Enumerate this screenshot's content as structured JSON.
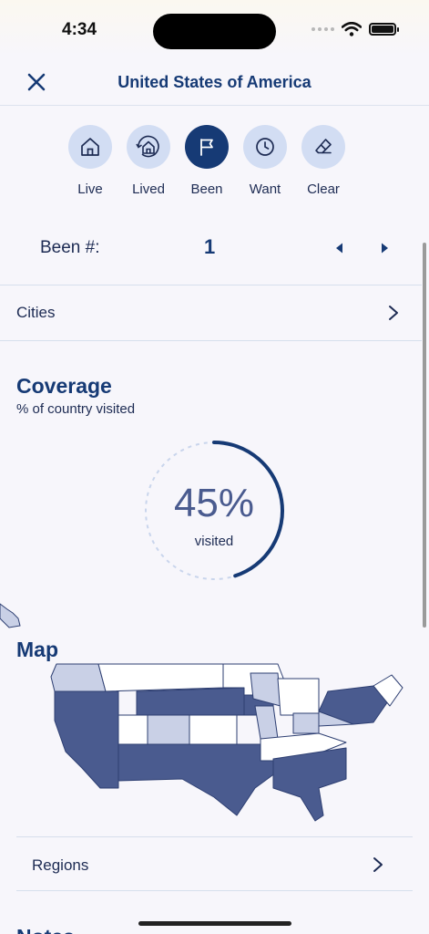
{
  "status_bar": {
    "time": "4:34"
  },
  "nav": {
    "title": "United States of America"
  },
  "statuses": [
    {
      "label": "Live",
      "icon": "house-icon",
      "active": false
    },
    {
      "label": "Lived",
      "icon": "house-history-icon",
      "active": false
    },
    {
      "label": "Been",
      "icon": "flag-icon",
      "active": true
    },
    {
      "label": "Want",
      "icon": "clock-icon",
      "active": false
    },
    {
      "label": "Clear",
      "icon": "eraser-icon",
      "active": false
    }
  ],
  "been": {
    "label": "Been #:",
    "value": "1"
  },
  "cities": {
    "label": "Cities"
  },
  "coverage": {
    "title": "Coverage",
    "subtitle": "% of country visited",
    "percent_label": "45%",
    "percent_value": 45,
    "visited_label": "visited"
  },
  "map": {
    "title": "Map",
    "colors": {
      "been": "#4a5b8f",
      "want": "#c9d0e6",
      "none": "#ffffff",
      "stroke": "#2e3f72"
    }
  },
  "regions": {
    "label": "Regions"
  },
  "notes": {
    "title": "Notes"
  },
  "colors": {
    "accent": "#163a75",
    "status_bg": "#d2ddf3",
    "text": "#1d2b53"
  }
}
